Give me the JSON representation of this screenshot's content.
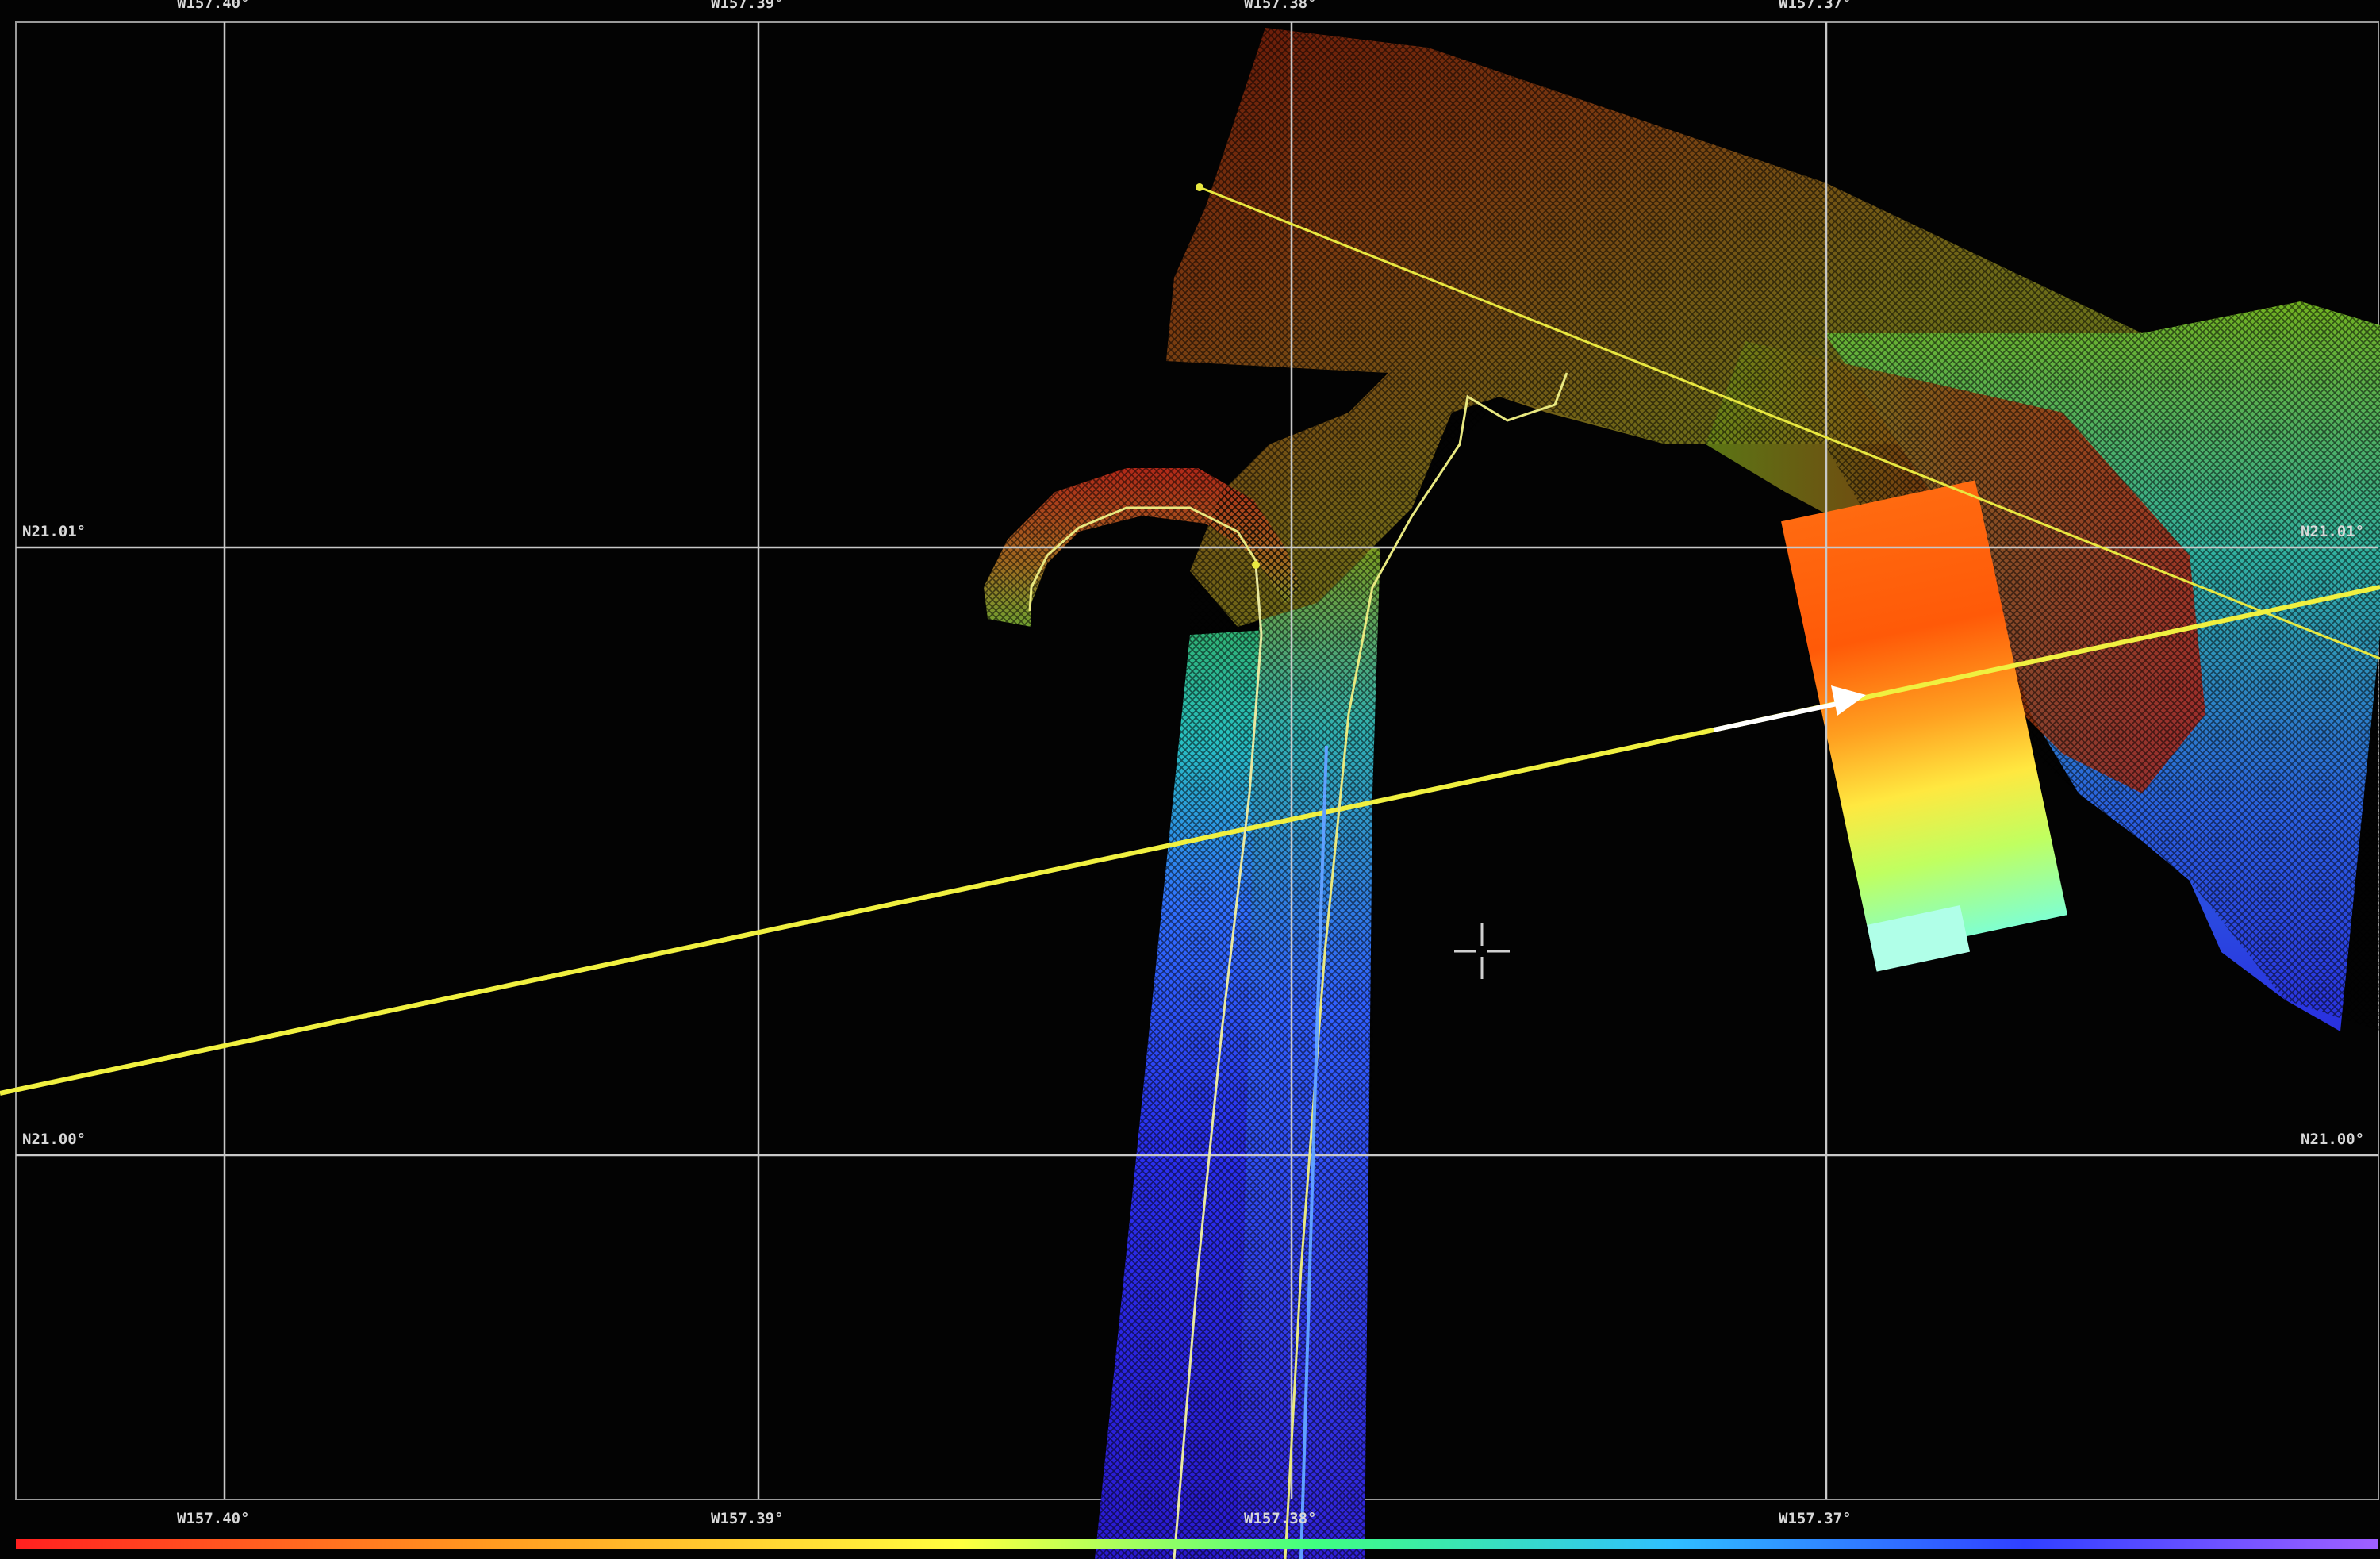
{
  "grid": {
    "lon_labels": [
      "W157.40°",
      "W157.39°",
      "W157.38°",
      "W157.37°"
    ],
    "lat_labels": [
      "N21.01°",
      "N21.00°"
    ]
  },
  "colors": {
    "grid_line": "#c8c8c8",
    "track_line": "#e8e840",
    "depth_scale": [
      "#ff2020",
      "#ff9a20",
      "#ffff40",
      "#40ff80",
      "#30c0ff",
      "#3040ff",
      "#a060ff"
    ]
  },
  "icons": {
    "cursor": "crosshair-icon",
    "vessel": "triangle-marker-icon"
  }
}
